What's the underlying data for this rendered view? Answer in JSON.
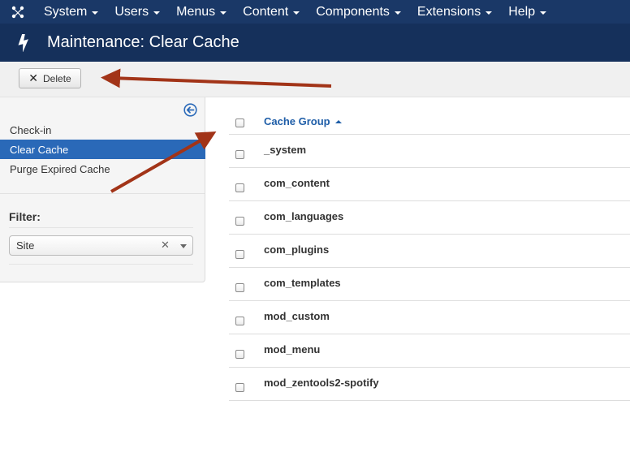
{
  "nav": {
    "items": [
      {
        "label": "System"
      },
      {
        "label": "Users"
      },
      {
        "label": "Menus"
      },
      {
        "label": "Content"
      },
      {
        "label": "Components"
      },
      {
        "label": "Extensions"
      },
      {
        "label": "Help"
      }
    ]
  },
  "header": {
    "title": "Maintenance: Clear Cache",
    "icon": "lightning-bolt-icon"
  },
  "toolbar": {
    "delete_label": "Delete"
  },
  "sidebar": {
    "items": [
      {
        "label": "Check-in"
      },
      {
        "label": "Clear Cache",
        "active": true
      },
      {
        "label": "Purge Expired Cache"
      }
    ],
    "filter_label": "Filter:",
    "filter_value": "Site"
  },
  "table": {
    "header": "Cache Group",
    "rows": [
      "_system",
      "com_content",
      "com_languages",
      "com_plugins",
      "com_templates",
      "mod_custom",
      "mod_menu",
      "mod_zentools2-spotify"
    ]
  },
  "colors": {
    "nav_bg": "#1a3867",
    "header_bg": "#15305b",
    "active_item": "#2a69b8",
    "link": "#1f5ea8",
    "annotation_arrow": "#a23418"
  }
}
